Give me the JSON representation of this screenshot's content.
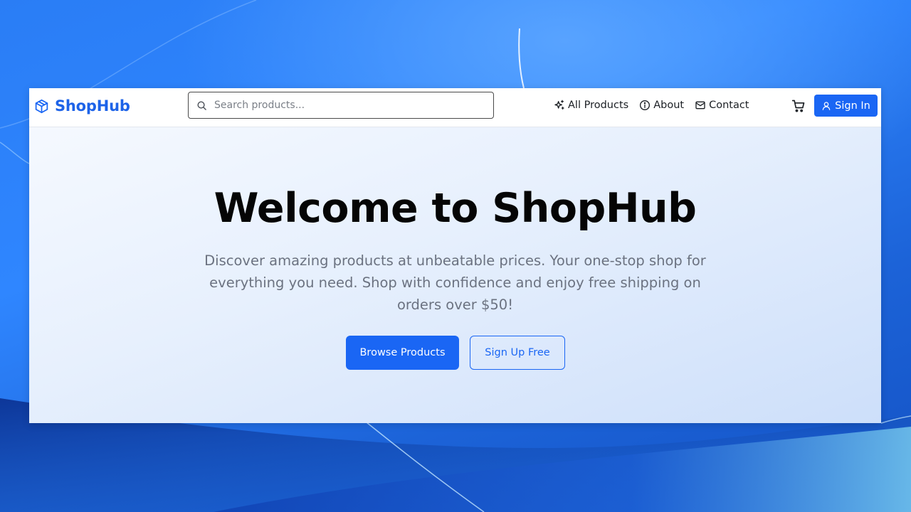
{
  "navbar": {
    "brand": "ShopHub",
    "search": {
      "placeholder": "Search products...",
      "value": ""
    },
    "links": [
      {
        "label": "All Products",
        "icon": "sparkles-icon"
      },
      {
        "label": "About",
        "icon": "info-icon"
      },
      {
        "label": "Contact",
        "icon": "mail-icon"
      }
    ],
    "cart_icon": "cart-icon",
    "sign_in_label": "Sign In"
  },
  "hero": {
    "title": "Welcome to ShopHub",
    "subtitle": "Discover amazing products at unbeatable prices. Your one-stop shop for everything you need. Shop with confidence and enjoy free shipping on orders over $50!",
    "primary_button": "Browse Products",
    "secondary_button": "Sign Up Free"
  },
  "colors": {
    "accent": "#1a66f4",
    "title": "#050505",
    "subtitle": "#6b7280"
  }
}
